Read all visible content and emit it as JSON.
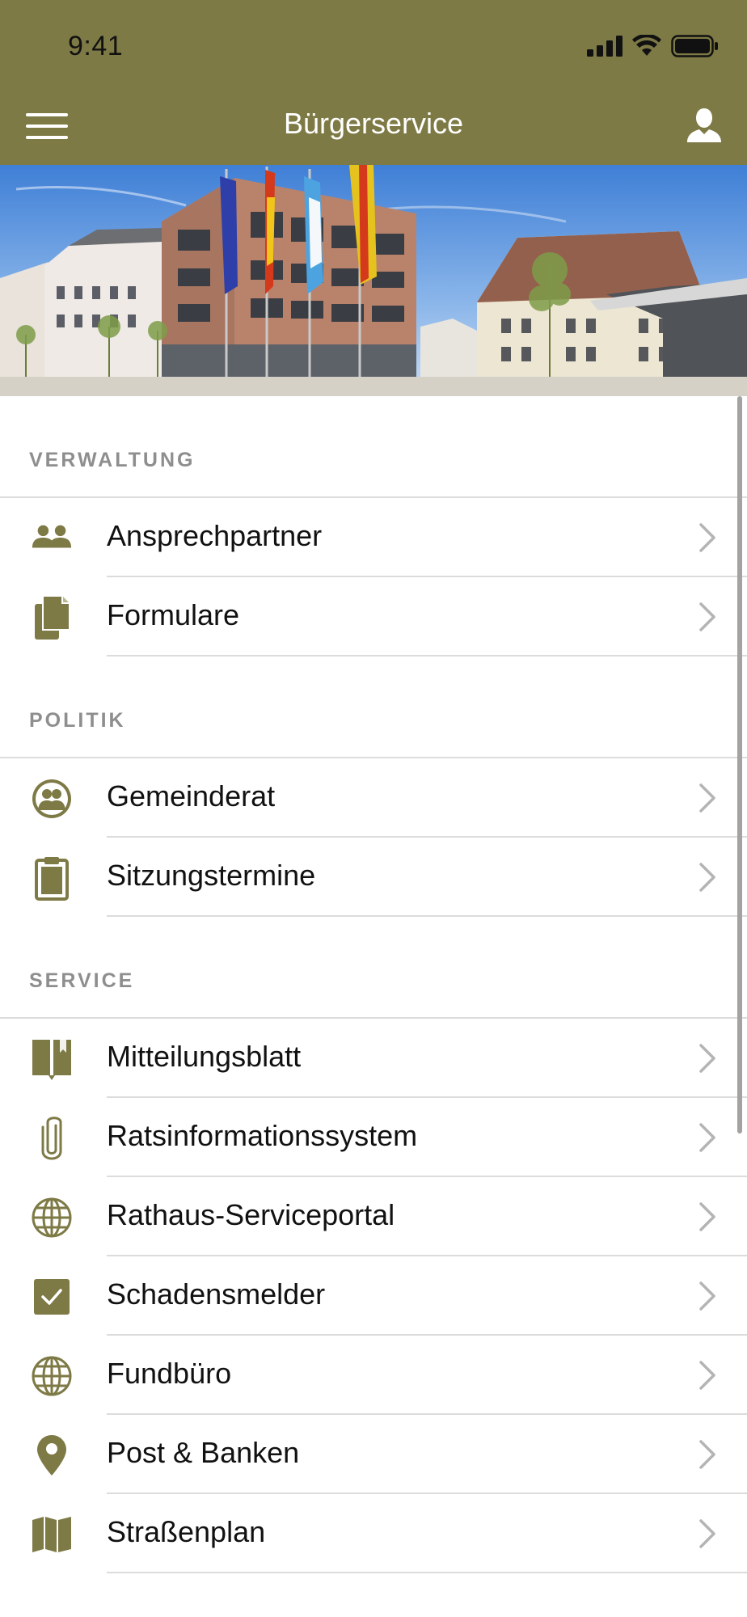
{
  "status_bar": {
    "time": "9:41"
  },
  "header": {
    "title": "Bürgerservice",
    "menu_icon": "hamburger-menu-icon",
    "user_icon": "user-icon"
  },
  "hero": {
    "description_icon": "town-hall-photo"
  },
  "colors": {
    "accent": "#7e7a46",
    "section_label": "#8e8e8e",
    "separator": "#dcdcdc",
    "chevron": "#b4b4b4"
  },
  "sections": [
    {
      "label": "VERWALTUNG",
      "items": [
        {
          "label": "Ansprechpartner",
          "icon": "people-icon"
        },
        {
          "label": "Formulare",
          "icon": "documents-icon"
        }
      ]
    },
    {
      "label": "POLITIK",
      "items": [
        {
          "label": "Gemeinderat",
          "icon": "council-icon"
        },
        {
          "label": "Sitzungstermine",
          "icon": "clipboard-icon"
        }
      ]
    },
    {
      "label": "SERVICE",
      "items": [
        {
          "label": "Mitteilungsblatt",
          "icon": "book-icon"
        },
        {
          "label": "Ratsinformationssystem",
          "icon": "paperclip-icon"
        },
        {
          "label": "Rathaus-Serviceportal",
          "icon": "globe-icon"
        },
        {
          "label": "Schadensmelder",
          "icon": "checkbox-icon"
        },
        {
          "label": "Fundbüro",
          "icon": "globe-icon"
        },
        {
          "label": "Post & Banken",
          "icon": "map-pin-icon"
        },
        {
          "label": "Straßenplan",
          "icon": "map-icon"
        }
      ]
    }
  ]
}
